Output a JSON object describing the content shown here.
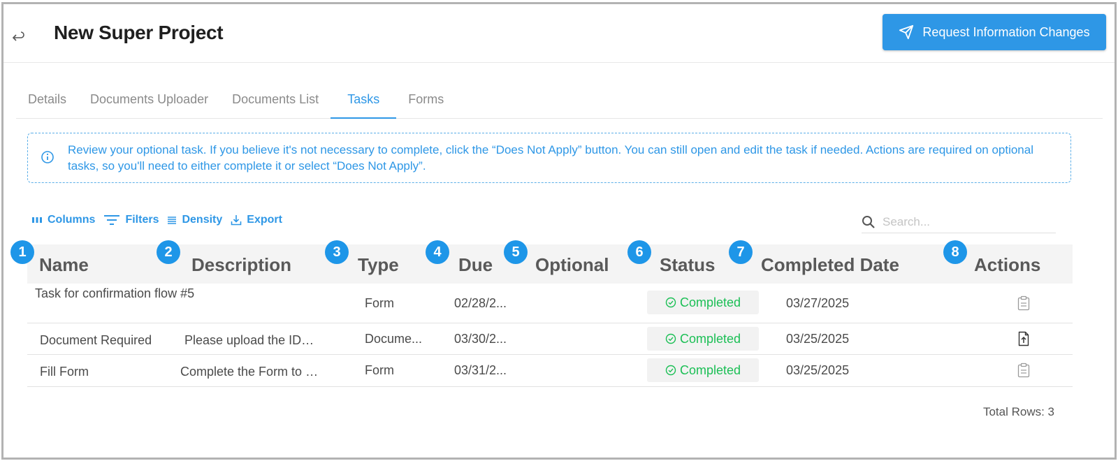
{
  "header": {
    "title": "New Super Project",
    "request_button_label": "Request Information Changes",
    "accent_color": "#2e97e6"
  },
  "tabs": [
    {
      "label": "Details",
      "active": false
    },
    {
      "label": "Documents Uploader",
      "active": false
    },
    {
      "label": "Documents List",
      "active": false
    },
    {
      "label": "Tasks",
      "active": true
    },
    {
      "label": "Forms",
      "active": false
    }
  ],
  "info_banner": {
    "icon": "info-icon",
    "text": "Review your optional task. If you believe it's not necessary to complete, click the “Does Not Apply” button. You can still open and edit the task if needed. Actions are required on optional tasks, so you'll need to either complete it or select “Does Not Apply”."
  },
  "toolbar": {
    "columns_label": "Columns",
    "filters_label": "Filters",
    "density_label": "Density",
    "export_label": "Export",
    "search_placeholder": "Search..."
  },
  "table": {
    "columns": [
      {
        "marker": "1",
        "label": "Name"
      },
      {
        "marker": "2",
        "label": "Description"
      },
      {
        "marker": "3",
        "label": "Type"
      },
      {
        "marker": "4",
        "label": "Due"
      },
      {
        "marker": "5",
        "label": "Optional"
      },
      {
        "marker": "6",
        "label": "Status"
      },
      {
        "marker": "7",
        "label": "Completed Date"
      },
      {
        "marker": "8",
        "label": "Actions"
      }
    ],
    "rows": [
      {
        "name": "Task for confirmation flow #5",
        "description": "",
        "type": "Form",
        "due": "02/28/2...",
        "optional": "",
        "status": "Completed",
        "completed_date": "03/27/2025",
        "action_icon": "clipboard-icon"
      },
      {
        "name": "Document Required",
        "description": "Please upload the ID…",
        "type": "Docume...",
        "due": "03/30/2...",
        "optional": "",
        "status": "Completed",
        "completed_date": "03/25/2025",
        "action_icon": "file-upload-icon"
      },
      {
        "name": "Fill Form",
        "description": "Complete the Form to …",
        "type": "Form",
        "due": "03/31/2...",
        "optional": "",
        "status": "Completed",
        "completed_date": "03/25/2025",
        "action_icon": "clipboard-icon"
      }
    ],
    "total_rows_label": "Total Rows: 3",
    "status_color": "#1bbf55",
    "marker_color": "#1e96e8"
  }
}
